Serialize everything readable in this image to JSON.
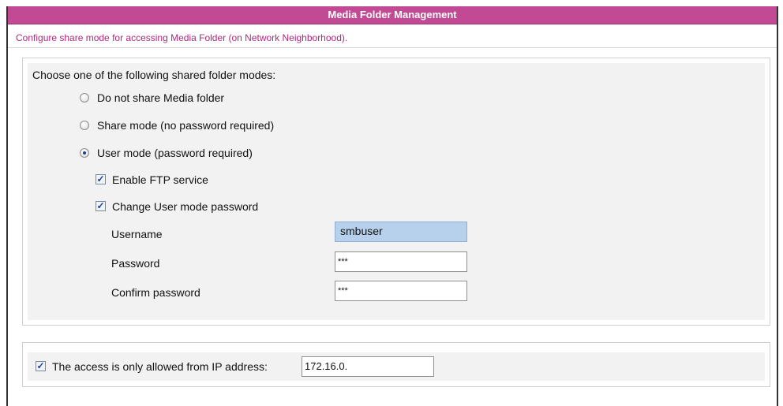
{
  "panel": {
    "title": "Media Folder Management",
    "description": "Configure share mode for accessing Media Folder (on Network Neighborhood)."
  },
  "share_modes": {
    "prompt": "Choose one of the following shared folder modes:",
    "options": [
      {
        "label": "Do not share Media folder",
        "selected": false
      },
      {
        "label": "Share mode (no password required)",
        "selected": false
      },
      {
        "label": "User mode (password required)",
        "selected": true
      }
    ],
    "enable_ftp": {
      "label": "Enable FTP service",
      "checked": true
    },
    "change_password": {
      "label": "Change User mode password",
      "checked": true
    },
    "username": {
      "label": "Username",
      "value": "smbuser"
    },
    "password": {
      "label": "Password",
      "value": "***"
    },
    "confirm_password": {
      "label": "Confirm password",
      "value": "***"
    }
  },
  "ip_restriction": {
    "label": "The access is only allowed from IP address:",
    "checked": true,
    "value": "172.16.0."
  },
  "colors": {
    "title_bar": "#c24a94",
    "description_text": "#b0287e",
    "section_bg": "#f2f2f2",
    "username_highlight": "#b7d1ed"
  }
}
